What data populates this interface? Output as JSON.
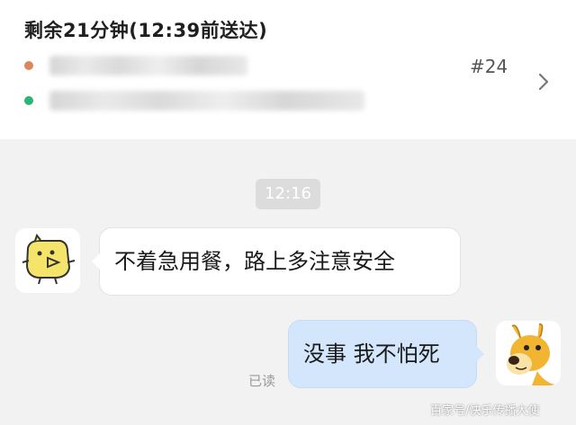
{
  "order": {
    "title": "剩余21分钟(12:39前送达)",
    "number": "#24"
  },
  "chat": {
    "timestamp": "12:16",
    "messages": [
      {
        "side": "left",
        "text": "不着急用餐，路上多注意安全"
      },
      {
        "side": "right",
        "text": "没事 我不怕死"
      }
    ],
    "read_status": "已读"
  },
  "watermark": "百家号/快乐传播大使",
  "colors": {
    "dot_orange": "#e0855a",
    "dot_green": "#2db37a",
    "bubble_blue": "#d4e6fb",
    "background": "#f2f2f2"
  }
}
